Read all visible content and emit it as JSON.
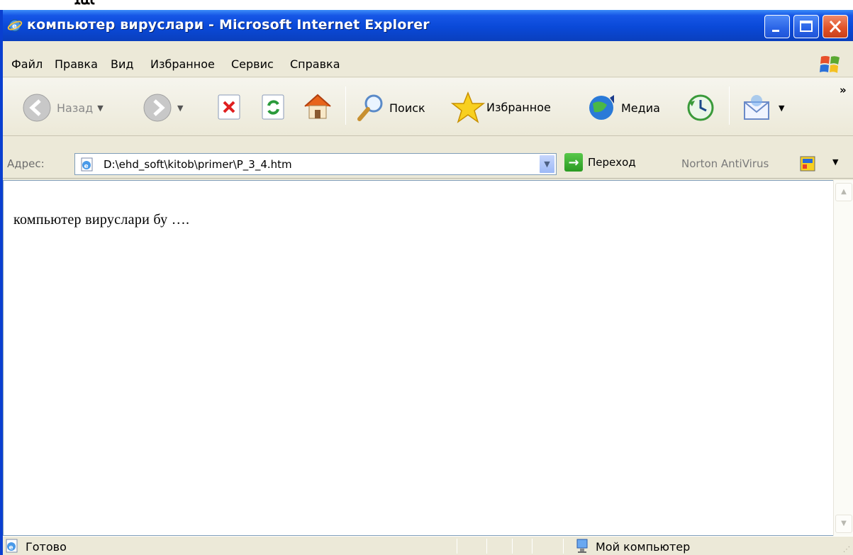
{
  "page_top_text": "ﺎﻨﺎﻨ",
  "window": {
    "title": "компьютер вируслари - Microsoft Internet Explorer"
  },
  "menu": {
    "items": [
      "Файл",
      "Правка",
      "Вид",
      "Избранное",
      "Сервис",
      "Справка"
    ]
  },
  "toolbar": {
    "back_label": "Назад",
    "search_label": "Поиск",
    "favorites_label": "Избранное",
    "media_label": "Медиа",
    "more": "»"
  },
  "address": {
    "label": "Адрес:",
    "value": "D:\\ehd_soft\\kitob\\primer\\P_3_4.htm",
    "go_label": "Переход",
    "norton_label": "Norton AntiVirus"
  },
  "content": {
    "text": "компьютер вируслари бу …."
  },
  "status": {
    "text": "Готово",
    "zone": "Мой компьютер"
  },
  "colors": {
    "titlebar": "#0a49d8",
    "chrome": "#ece9d8",
    "close_button": "#e2542a"
  }
}
